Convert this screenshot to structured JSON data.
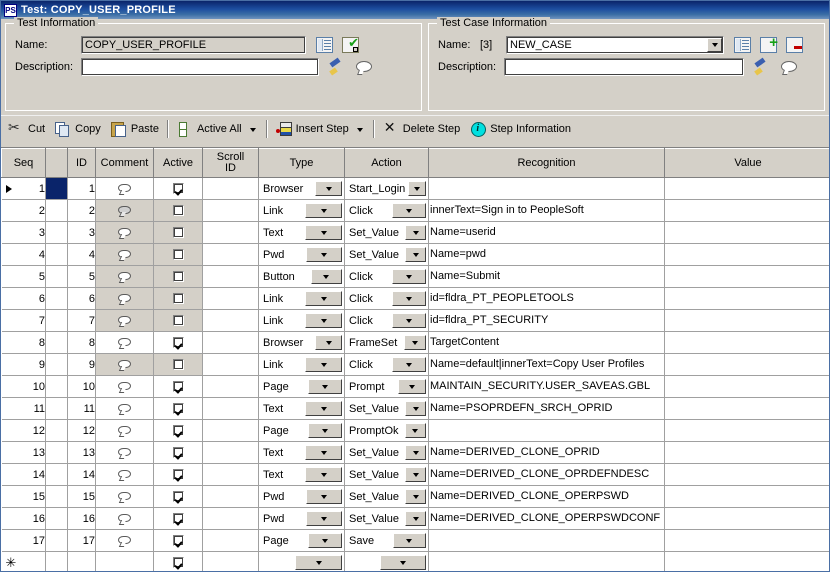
{
  "window": {
    "title": "Test: COPY_USER_PROFILE",
    "icon": "ps-app-icon",
    "icon_label": "PS"
  },
  "test_information": {
    "legend": "Test Information",
    "name_label": "Name:",
    "name_value": "COPY_USER_PROFILE",
    "description_label": "Description:",
    "description_value": "",
    "description_placeholder": "",
    "icons": [
      "details-icon",
      "validate-icon",
      "clear-brush-icon",
      "comment-bubble-icon"
    ]
  },
  "test_case_information": {
    "legend": "Test Case Information",
    "name_label": "Name:",
    "name_index": "[3]",
    "name_value": "NEW_CASE",
    "description_label": "Description:",
    "description_value": "",
    "icons": [
      "details-icon",
      "add-case-icon",
      "remove-case-icon",
      "clear-brush-icon",
      "comment-bubble-icon"
    ]
  },
  "toolbar": {
    "cut": "Cut",
    "copy": "Copy",
    "paste": "Paste",
    "active_all": "Active All",
    "insert_step": "Insert Step",
    "delete_step": "Delete Step",
    "step_information": "Step Information"
  },
  "grid": {
    "columns": [
      "Seq",
      "",
      "ID",
      "Comment",
      "Active",
      "Scroll ID",
      "Type",
      "Action",
      "Recognition",
      "Value"
    ],
    "column_scroll_line1": "Scroll",
    "column_scroll_line2": "ID",
    "new_row_marker": "✳",
    "rows": [
      {
        "seq": "1",
        "id": "1",
        "comment": "empty",
        "active": true,
        "scroll_id": "",
        "type": "Browser",
        "action": "Start_Login",
        "recognition": "",
        "value": "",
        "selected": true
      },
      {
        "seq": "2",
        "id": "2",
        "comment": "filled",
        "active": false,
        "scroll_id": "",
        "type": "Link",
        "action": "Click",
        "recognition": "innerText=Sign in to PeopleSoft",
        "value": ""
      },
      {
        "seq": "3",
        "id": "3",
        "comment": "empty",
        "active": false,
        "scroll_id": "",
        "type": "Text",
        "action": "Set_Value",
        "recognition": "Name=userid",
        "value": ""
      },
      {
        "seq": "4",
        "id": "4",
        "comment": "empty",
        "active": false,
        "scroll_id": "",
        "type": "Pwd",
        "action": "Set_Value",
        "recognition": "Name=pwd",
        "value": ""
      },
      {
        "seq": "5",
        "id": "5",
        "comment": "empty",
        "active": false,
        "scroll_id": "",
        "type": "Button",
        "action": "Click",
        "recognition": "Name=Submit",
        "value": ""
      },
      {
        "seq": "6",
        "id": "6",
        "comment": "empty",
        "active": false,
        "scroll_id": "",
        "type": "Link",
        "action": "Click",
        "recognition": "id=fldra_PT_PEOPLETOOLS",
        "value": ""
      },
      {
        "seq": "7",
        "id": "7",
        "comment": "empty",
        "active": false,
        "scroll_id": "",
        "type": "Link",
        "action": "Click",
        "recognition": "id=fldra_PT_SECURITY",
        "value": ""
      },
      {
        "seq": "8",
        "id": "8",
        "comment": "empty",
        "active": true,
        "scroll_id": "",
        "type": "Browser",
        "action": "FrameSet",
        "recognition": "TargetContent",
        "value": ""
      },
      {
        "seq": "9",
        "id": "9",
        "comment": "empty",
        "active": false,
        "scroll_id": "",
        "type": "Link",
        "action": "Click",
        "recognition": "Name=default|innerText=Copy User Profiles",
        "value": ""
      },
      {
        "seq": "10",
        "id": "10",
        "comment": "empty",
        "active": true,
        "scroll_id": "",
        "type": "Page",
        "action": "Prompt",
        "recognition": "MAINTAIN_SECURITY.USER_SAVEAS.GBL",
        "value": ""
      },
      {
        "seq": "11",
        "id": "11",
        "comment": "empty",
        "active": true,
        "scroll_id": "",
        "type": "Text",
        "action": "Set_Value",
        "recognition": "Name=PSOPRDEFN_SRCH_OPRID",
        "value": ""
      },
      {
        "seq": "12",
        "id": "12",
        "comment": "empty",
        "active": true,
        "scroll_id": "",
        "type": "Page",
        "action": "PromptOk",
        "recognition": "",
        "value": ""
      },
      {
        "seq": "13",
        "id": "13",
        "comment": "empty",
        "active": true,
        "scroll_id": "",
        "type": "Text",
        "action": "Set_Value",
        "recognition": "Name=DERIVED_CLONE_OPRID",
        "value": ""
      },
      {
        "seq": "14",
        "id": "14",
        "comment": "empty",
        "active": true,
        "scroll_id": "",
        "type": "Text",
        "action": "Set_Value",
        "recognition": "Name=DERIVED_CLONE_OPRDEFNDESC",
        "value": ""
      },
      {
        "seq": "15",
        "id": "15",
        "comment": "empty",
        "active": true,
        "scroll_id": "",
        "type": "Pwd",
        "action": "Set_Value",
        "recognition": "Name=DERIVED_CLONE_OPERPSWD",
        "value": ""
      },
      {
        "seq": "16",
        "id": "16",
        "comment": "empty",
        "active": true,
        "scroll_id": "",
        "type": "Pwd",
        "action": "Set_Value",
        "recognition": "Name=DERIVED_CLONE_OPERPSWDCONF",
        "value": ""
      },
      {
        "seq": "17",
        "id": "17",
        "comment": "empty",
        "active": true,
        "scroll_id": "",
        "type": "Page",
        "action": "Save",
        "recognition": "",
        "value": ""
      },
      {
        "seq": "*",
        "id": "",
        "comment": "none",
        "active": true,
        "scroll_id": "",
        "type": "",
        "action": "",
        "recognition": "",
        "value": "",
        "is_new": true
      }
    ]
  },
  "colors": {
    "titlebar_start": "#0a246a",
    "titlebar_end": "#6f93bf",
    "face": "#d4d0c8",
    "selection": "#0a246a",
    "grid_alt": "#f3f3f3"
  }
}
